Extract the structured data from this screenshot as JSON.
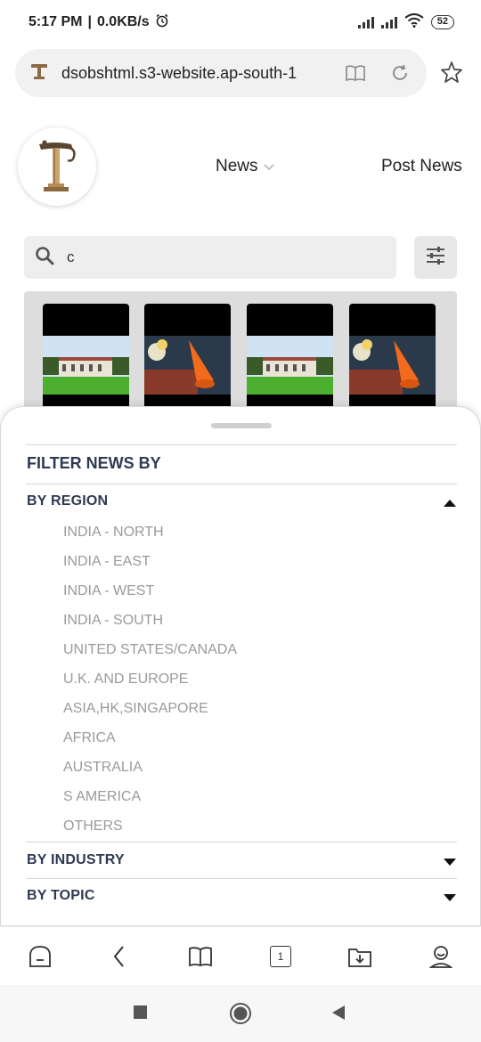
{
  "status": {
    "time": "5:17 PM",
    "speed": "0.0KB/s",
    "battery": "52",
    "icons": [
      "alarm-icon",
      "signal-icon",
      "signal-icon",
      "wifi-icon",
      "battery-icon"
    ]
  },
  "browser": {
    "url": "dsobshtml.s3-website.ap-south-1",
    "icons": [
      "site-logo-icon",
      "reader-mode-icon",
      "reload-icon",
      "bookmark-star-icon"
    ]
  },
  "header": {
    "nav_news": "News",
    "nav_post": "Post News"
  },
  "search": {
    "value": "c"
  },
  "thumbnails": [
    {
      "alt": "building-lawn-photo"
    },
    {
      "alt": "orange-megaphone-photo"
    },
    {
      "alt": "building-lawn-photo"
    },
    {
      "alt": "orange-megaphone-photo"
    }
  ],
  "filter": {
    "title": "FILTER NEWS BY",
    "by_region": "BY REGION",
    "regions": [
      "INDIA - NORTH",
      "INDIA - EAST",
      "INDIA - WEST",
      "INDIA - SOUTH",
      "UNITED STATES/CANADA",
      "U.K. AND EUROPE",
      "ASIA,HK,SINGAPORE",
      "AFRICA",
      "AUSTRALIA",
      "S AMERICA",
      "OTHERS"
    ],
    "by_industry": "BY INDUSTRY",
    "by_topic": "BY TOPIC"
  },
  "toolbar": {
    "tab_count": "1",
    "icons": [
      "home-icon",
      "back-icon",
      "bookmarks-icon",
      "tabs-icon",
      "downloads-icon",
      "profile-icon"
    ]
  },
  "colors": {
    "heading": "#2e3a52",
    "region_text": "#9a9a9a",
    "pill_bg": "#f1f1f1"
  }
}
